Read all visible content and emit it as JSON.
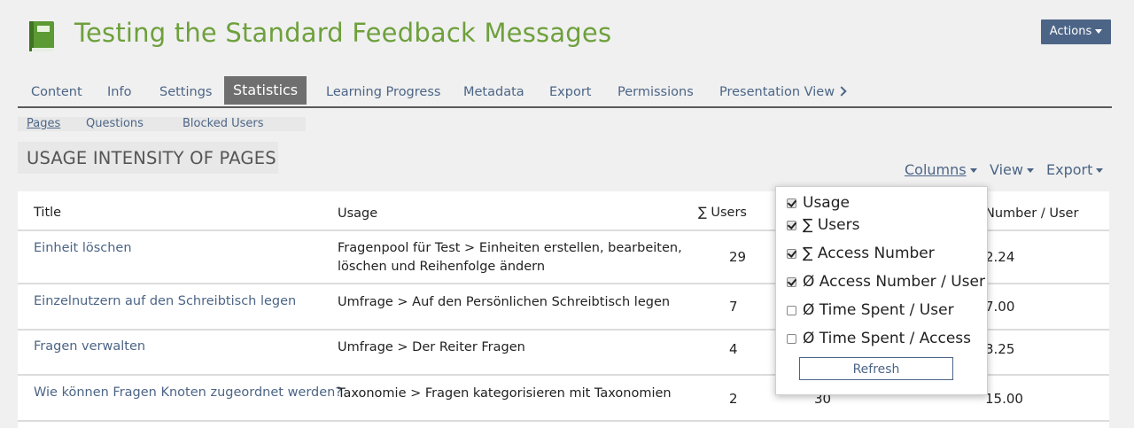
{
  "header": {
    "title": "Testing the Standard Feedback Messages",
    "icon": "book-icon",
    "actions_label": "Actions"
  },
  "tabs": [
    {
      "label": "Content"
    },
    {
      "label": "Info"
    },
    {
      "label": "Settings"
    },
    {
      "label": "Statistics",
      "active": true
    },
    {
      "label": "Learning Progress"
    },
    {
      "label": "Metadata"
    },
    {
      "label": "Export"
    },
    {
      "label": "Permissions"
    },
    {
      "label": "Presentation View"
    }
  ],
  "subtabs": [
    {
      "label": "Pages",
      "active": true
    },
    {
      "label": "Questions"
    },
    {
      "label": "Blocked Users"
    }
  ],
  "section": {
    "title": "USAGE INTENSITY OF PAGES"
  },
  "toolbar": {
    "columns": "Columns",
    "view": "View",
    "export": "Export"
  },
  "table": {
    "headers": [
      "Title",
      "Usage",
      "∑ Users",
      "Number / User"
    ],
    "rows": [
      {
        "title": "Einheit löschen",
        "usage_line1": "Fragenpool für Test > Einheiten erstellen, bearbeiten,",
        "usage_line2": "löschen und Reihenfolge ändern",
        "users": "29",
        "access": "",
        "per_user": "2.24"
      },
      {
        "title": "Einzelnutzern auf den Schreibtisch legen",
        "usage_line1": "Umfrage > Auf den Persönlichen Schreibtisch legen",
        "usage_line2": "",
        "users": "7",
        "access": "",
        "per_user": "7.00"
      },
      {
        "title": "Fragen verwalten",
        "usage_line1": "Umfrage > Der Reiter Fragen",
        "usage_line2": "",
        "users": "4",
        "access": "",
        "per_user": "3.25"
      },
      {
        "title": "Wie können Fragen Knoten zugeordnet werden?",
        "usage_line1": "Taxonomie > Fragen kategorisieren mit Taxonomien",
        "usage_line2": "",
        "users": "2",
        "access": "30",
        "per_user": "15.00"
      }
    ]
  },
  "columns_menu": {
    "options": [
      {
        "label": "Usage",
        "checked": true
      },
      {
        "label": "∑ Users",
        "checked": true
      },
      {
        "label": "∑ Access Number",
        "checked": true
      },
      {
        "label": "Ø Access Number / User",
        "checked": true
      },
      {
        "label": "Ø Time Spent / User",
        "checked": false
      },
      {
        "label": "Ø Time Spent / Access",
        "checked": false
      }
    ],
    "refresh_label": "Refresh"
  },
  "colors": {
    "title_green": "#6ea03c",
    "link_blue": "#4c6586",
    "active_tab": "#6f6f6f"
  }
}
